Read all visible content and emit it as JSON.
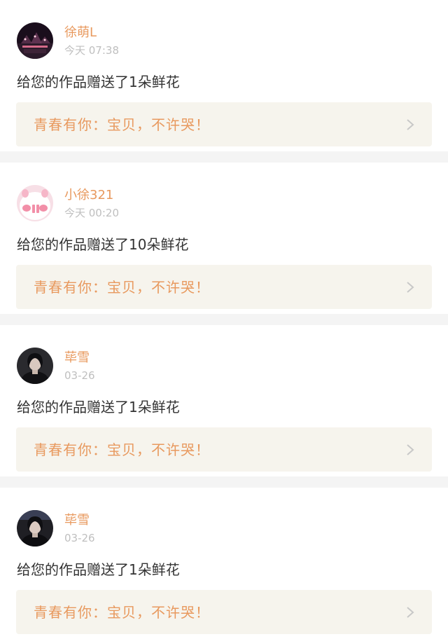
{
  "feed": [
    {
      "username": "徐萌L",
      "time": "今天 07:38",
      "message": "给您的作品赠送了1朵鲜花",
      "work_title": "青春有你：宝贝，不许哭！",
      "avatar_icon": "concert-stage-avatar-icon"
    },
    {
      "username": "小徐321",
      "time": "今天 00:20",
      "message": "给您的作品赠送了10朵鲜花",
      "work_title": "青春有你：宝贝，不许哭！",
      "avatar_icon": "pink-cartoon-pig-avatar-icon"
    },
    {
      "username": "荜雪",
      "time": "03-26",
      "message": "给您的作品赠送了1朵鲜花",
      "work_title": "青春有你：宝贝，不许哭！",
      "avatar_icon": "person-portrait-avatar-icon"
    },
    {
      "username": "荜雪",
      "time": "03-26",
      "message": "给您的作品赠送了1朵鲜花",
      "work_title": "青春有你：宝贝，不许哭！",
      "avatar_icon": "person-portrait-avatar-icon"
    }
  ],
  "colors": {
    "accent": "#e8995e",
    "link_bg": "#f6f4ed",
    "muted": "#bfbfbf",
    "top_indicator": "#f07aa6"
  }
}
